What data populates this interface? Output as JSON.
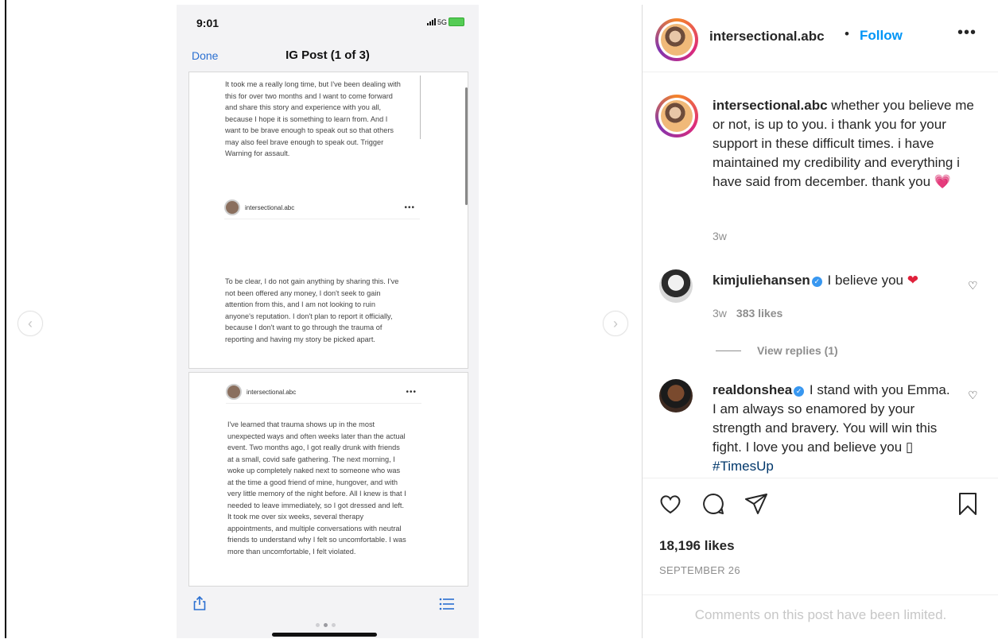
{
  "phone": {
    "time": "9:01",
    "network": "5G",
    "nav_done": "Done",
    "nav_title": "IG Post (1 of 3)",
    "paragraph1": "It took me a really long time, but I've been dealing with this for over two months and I want to come forward and share this story and experience with you all, because I hope it is something to learn from. And I want to be brave enough to speak out so that others may also feel brave enough to speak out. Trigger Warning for assault.",
    "embedded_username_1": "intersectional.abc",
    "paragraph2": "To be clear, I do not gain anything by sharing this. I've not been offered any money, I don't seek to gain attention from this, and I am not looking to ruin anyone's reputation. I don't plan to report it officially, because I don't want to go through the trauma of reporting and having my story be picked apart.",
    "embedded_username_2": "intersectional.abc",
    "paragraph3": "I've learned that trauma shows up in the most unexpected ways and often weeks later than the actual event. Two months ago, I got really drunk with friends at a small, covid safe gathering. The next morning, I woke up completely naked next to someone who was at the time a good friend of mine, hungover, and with very little memory of the night before. All I knew is that I needed to leave immediately, so I got dressed and left. It took me over six weeks, several therapy appointments, and multiple conversations with neutral friends to understand why I felt so uncomfortable. I was more than uncomfortable, I felt violated."
  },
  "header": {
    "username": "intersectional.abc",
    "separator": "•",
    "follow_label": "Follow",
    "more_label": "•••"
  },
  "caption": {
    "username": "intersectional.abc",
    "text": " whether you believe me or not, is up to you. i thank you for your support in these difficult times. i have maintained my credibility and everything i have said from december. thank you ",
    "emoji": "💗",
    "time": "3w"
  },
  "comments": [
    {
      "username": "kimjuliehansen",
      "text": " I believe you ",
      "emoji": "❤",
      "time": "3w",
      "likes": "383 likes",
      "view_replies": "View replies (1)"
    },
    {
      "username": "realdonshea",
      "text": " I stand with you Emma. I am always so enamored by your strength and bravery. You will win this fight. I love you and believe you ",
      "glyph": "▯",
      "hashtag": "#TimesUp"
    }
  ],
  "likes_count": "18,196 likes",
  "post_date": "SEPTEMBER 26",
  "limited_notice": "Comments on this post have been limited.",
  "icons": {
    "prev": "chevron-left-icon",
    "next": "chevron-right-icon",
    "like": "heart-outline-icon",
    "comment": "comment-bubble-icon",
    "share": "paper-plane-icon",
    "save": "bookmark-icon"
  },
  "colors": {
    "accent": "#0095f6",
    "ios_blue": "#2a6fd1",
    "text": "#262626",
    "muted": "#8e8e8e",
    "hashtag": "#00376b"
  }
}
